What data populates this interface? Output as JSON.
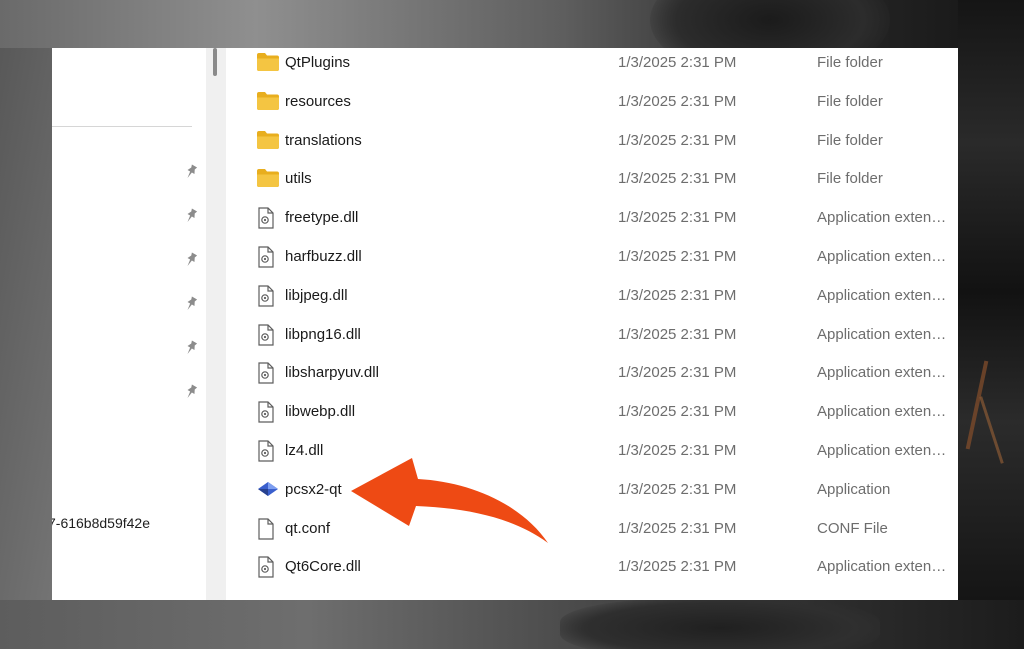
{
  "nav": {
    "partial_text": "7-616b8d59f42e",
    "pin_icon": "pin-icon",
    "pin_count": 6
  },
  "files": [
    {
      "name": "QtPlugins",
      "date": "1/3/2025 2:31 PM",
      "type": "File folder",
      "icon": "folder-icon"
    },
    {
      "name": "resources",
      "date": "1/3/2025 2:31 PM",
      "type": "File folder",
      "icon": "folder-icon"
    },
    {
      "name": "translations",
      "date": "1/3/2025 2:31 PM",
      "type": "File folder",
      "icon": "folder-icon"
    },
    {
      "name": "utils",
      "date": "1/3/2025 2:31 PM",
      "type": "File folder",
      "icon": "folder-icon"
    },
    {
      "name": "freetype.dll",
      "date": "1/3/2025 2:31 PM",
      "type": "Application exten…",
      "icon": "dll-file-icon"
    },
    {
      "name": "harfbuzz.dll",
      "date": "1/3/2025 2:31 PM",
      "type": "Application exten…",
      "icon": "dll-file-icon"
    },
    {
      "name": "libjpeg.dll",
      "date": "1/3/2025 2:31 PM",
      "type": "Application exten…",
      "icon": "dll-file-icon"
    },
    {
      "name": "libpng16.dll",
      "date": "1/3/2025 2:31 PM",
      "type": "Application exten…",
      "icon": "dll-file-icon"
    },
    {
      "name": "libsharpyuv.dll",
      "date": "1/3/2025 2:31 PM",
      "type": "Application exten…",
      "icon": "dll-file-icon"
    },
    {
      "name": "libwebp.dll",
      "date": "1/3/2025 2:31 PM",
      "type": "Application exten…",
      "icon": "dll-file-icon"
    },
    {
      "name": "lz4.dll",
      "date": "1/3/2025 2:31 PM",
      "type": "Application exten…",
      "icon": "dll-file-icon"
    },
    {
      "name": "pcsx2-qt",
      "date": "1/3/2025 2:31 PM",
      "type": "Application",
      "icon": "pcsx2-app-icon"
    },
    {
      "name": "qt.conf",
      "date": "1/3/2025 2:31 PM",
      "type": "CONF File",
      "icon": "blank-file-icon"
    },
    {
      "name": "Qt6Core.dll",
      "date": "1/3/2025 2:31 PM",
      "type": "Application exten…",
      "icon": "dll-file-icon"
    }
  ],
  "colors": {
    "folder": "#f4c542",
    "arrow": "#ee4a14",
    "pcsx2_icon": "#3a5fcd"
  }
}
